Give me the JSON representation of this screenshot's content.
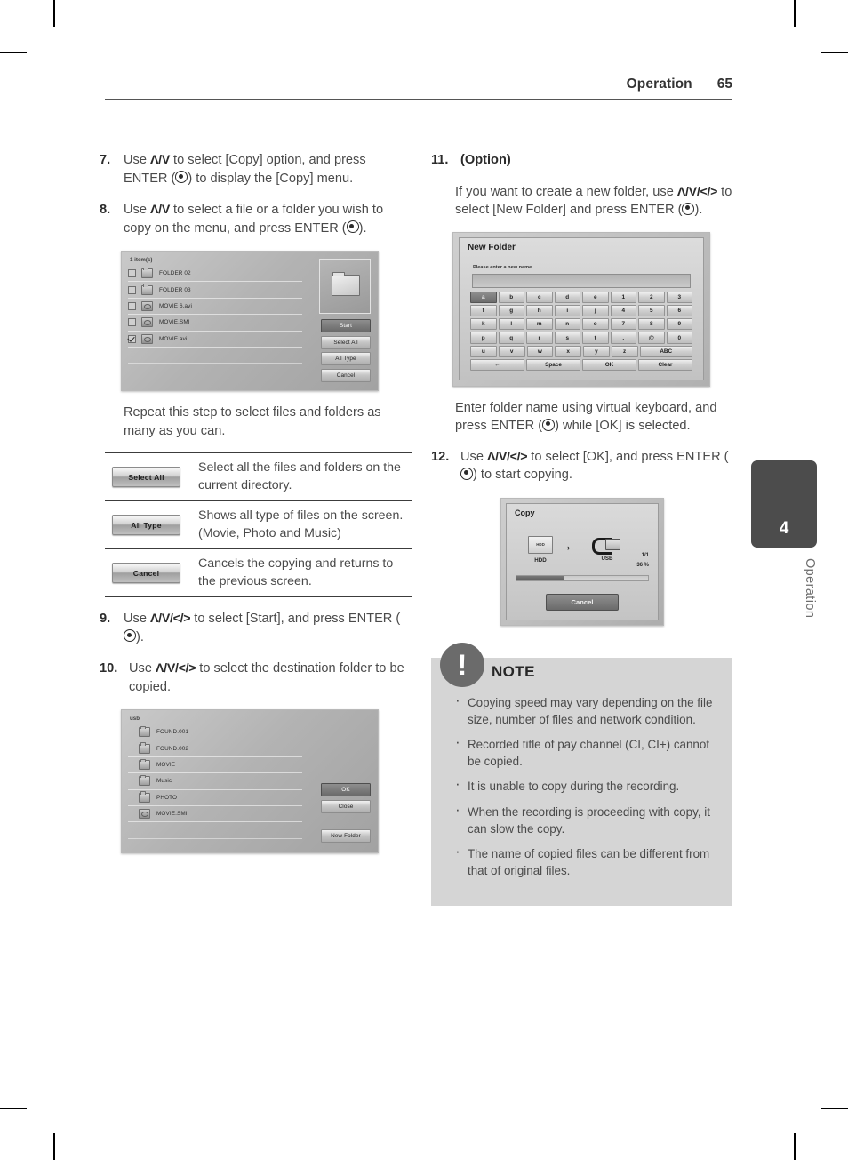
{
  "header": {
    "title": "Operation",
    "page": "65"
  },
  "left": {
    "step7": {
      "num": "7.",
      "text_a": "Use ",
      "arrows": "Λ/V",
      "text_b": " to select [Copy] option, and press ENTER (",
      "text_c": ") to display the [Copy] menu."
    },
    "step8": {
      "num": "8.",
      "text_a": "Use ",
      "arrows": "Λ/V",
      "text_b": " to select a file or a folder you wish to copy on the menu, and press ENTER (",
      "text_c": ")."
    },
    "repeat_para": "Repeat this step to select files and folders as many as you can.",
    "step9": {
      "num": "9.",
      "text_a": "Use ",
      "arrows": "Λ/V/</>",
      "text_b": " to select [Start], and press ENTER (",
      "text_c": ")."
    },
    "step10": {
      "num": "10.",
      "text_a": "Use ",
      "arrows": "Λ/V/</>",
      "text_b": " to select the destination folder to be copied."
    }
  },
  "file_browser": {
    "count_label": "1 item(s)",
    "items": [
      {
        "name": "FOLDER 02",
        "icon": "folder-icon",
        "checked": false
      },
      {
        "name": "FOLDER 03",
        "icon": "folder-icon",
        "checked": false
      },
      {
        "name": "MOVIE 6.avi",
        "icon": "movie-file-icon",
        "checked": false
      },
      {
        "name": "MOVIE.SMI",
        "icon": "movie-file-icon",
        "checked": false
      },
      {
        "name": "MOVIE.avi",
        "icon": "movie-file-icon",
        "checked": true
      }
    ],
    "buttons": [
      {
        "label": "Start",
        "selected": true
      },
      {
        "label": "Select All",
        "selected": false
      },
      {
        "label": "All Type",
        "selected": false
      },
      {
        "label": "Cancel",
        "selected": false
      }
    ]
  },
  "button_table": [
    {
      "button": "Select All",
      "description": "Select all the files and folders on the current directory."
    },
    {
      "button": "All Type",
      "description": "Shows all type of files on the screen. (Movie, Photo and Music)"
    },
    {
      "button": "Cancel",
      "description": "Cancels the copying and returns to the previous screen."
    }
  ],
  "destination_browser": {
    "count_label": "usb",
    "items": [
      {
        "name": "FOUND.001",
        "icon": "folder-icon"
      },
      {
        "name": "FOUND.002",
        "icon": "folder-icon"
      },
      {
        "name": "MOVIE",
        "icon": "folder-icon"
      },
      {
        "name": "Music",
        "icon": "folder-icon"
      },
      {
        "name": "PHOTO",
        "icon": "folder-icon"
      },
      {
        "name": "MOVIE.SMI",
        "icon": "movie-file-icon"
      }
    ],
    "buttons": [
      {
        "label": "OK",
        "selected": true
      },
      {
        "label": "Close",
        "selected": false
      },
      {
        "label": "New Folder",
        "selected": false
      }
    ]
  },
  "right": {
    "step11": {
      "num": "11.",
      "option_label": "(Option)",
      "text_a": "If you want to create a new folder, use ",
      "arrows": "Λ/V/</>",
      "text_b": " to select [New Folder] and press ENTER (",
      "text_c": ")."
    },
    "keyboard_para_a": "Enter folder name using virtual keyboard, and press ENTER (",
    "keyboard_para_b": ") while [OK] is selected.",
    "step12": {
      "num": "12.",
      "text_a": "Use ",
      "arrows": "Λ/V/</>",
      "text_b": " to select [OK], and press ENTER (",
      "text_c": ") to start copying."
    }
  },
  "new_folder_dialog": {
    "title": "New Folder",
    "prompt": "Please enter a new name",
    "input_value": "",
    "keys": {
      "row1": [
        "a",
        "b",
        "c",
        "d",
        "e",
        "1",
        "2",
        "3"
      ],
      "row2": [
        "f",
        "g",
        "h",
        "i",
        "j",
        "4",
        "5",
        "6"
      ],
      "row3": [
        "k",
        "l",
        "m",
        "n",
        "o",
        "7",
        "8",
        "9"
      ],
      "row4": [
        "p",
        "q",
        "r",
        "s",
        "t",
        ".",
        "@",
        "0"
      ],
      "row5": [
        "u",
        "v",
        "w",
        "x",
        "y",
        "z",
        "ABC"
      ],
      "row6": [
        "←",
        "Space",
        "OK",
        "Clear"
      ]
    },
    "selected_key": "a"
  },
  "copy_dialog": {
    "title": "Copy",
    "source": "HDD",
    "source_icon_label": "HDD",
    "destination": "USB",
    "arrow": "›",
    "count": "1/1",
    "percent": "36 %",
    "progress": 36,
    "cancel_label": "Cancel"
  },
  "note": {
    "title": "NOTE",
    "badge": "!",
    "items": [
      "Copying speed may vary depending on the file size, number of files and network condition.",
      "Recorded title of pay channel (CI, CI+) cannot be copied.",
      "It is unable to copy during the recording.",
      "When the recording is proceeding with copy, it can slow the copy.",
      "The name of copied files can be different from that of original files."
    ]
  },
  "chapter_tab": {
    "number": "4",
    "label": "Operation"
  }
}
